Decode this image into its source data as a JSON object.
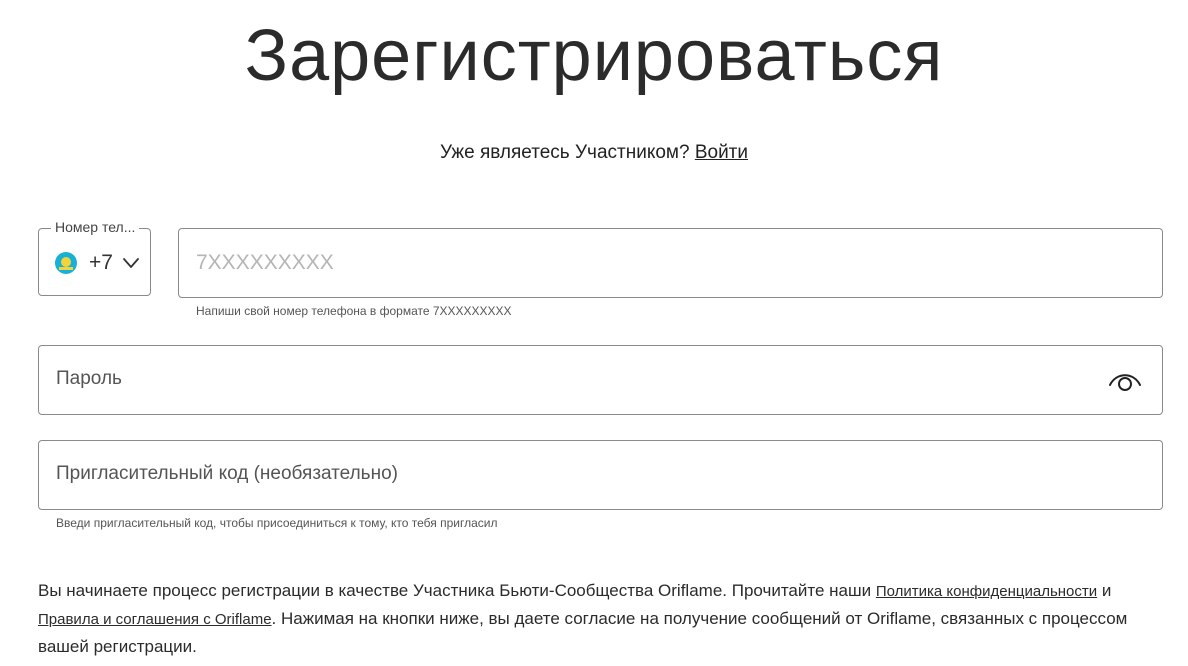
{
  "header": {
    "title": "Зарегистрироваться"
  },
  "login": {
    "prompt": "Уже являетесь Участником?",
    "link_label": "Войти"
  },
  "phone": {
    "country_label": "Номер тел...",
    "dial_code": "+7",
    "placeholder": "7XXXXXXXXX",
    "hint": "Напиши свой номер телефона в формате 7XXXXXXXXX"
  },
  "password": {
    "label": "Пароль"
  },
  "invite": {
    "label": "Пригласительный код (необязательно)",
    "hint": "Введи пригласительный код, чтобы присоединиться к тому, кто тебя пригласил"
  },
  "consent": {
    "text_1": "Вы начинаете процесс регистрации в качестве Участника Бьюти-Сообщества Oriflame. Прочитайте наши ",
    "privacy_link": "Политика конфиденциальности",
    "and": " и ",
    "terms_link": "Правила и соглашения с Oriflame",
    "text_2": ". Нажимая на кнопки ниже, вы даете согласие на получение сообщений от Oriflame, связанных с процессом вашей регистрации."
  },
  "icons": {
    "flag": "kazakhstan-flag-icon",
    "chevron": "chevron-down-icon",
    "eye": "eye-icon"
  },
  "colors": {
    "border": "#8a8a8a",
    "text": "#222222",
    "placeholder": "#b5b5b5",
    "flag_blue": "#18b0d6",
    "flag_yellow": "#f4d23a"
  }
}
